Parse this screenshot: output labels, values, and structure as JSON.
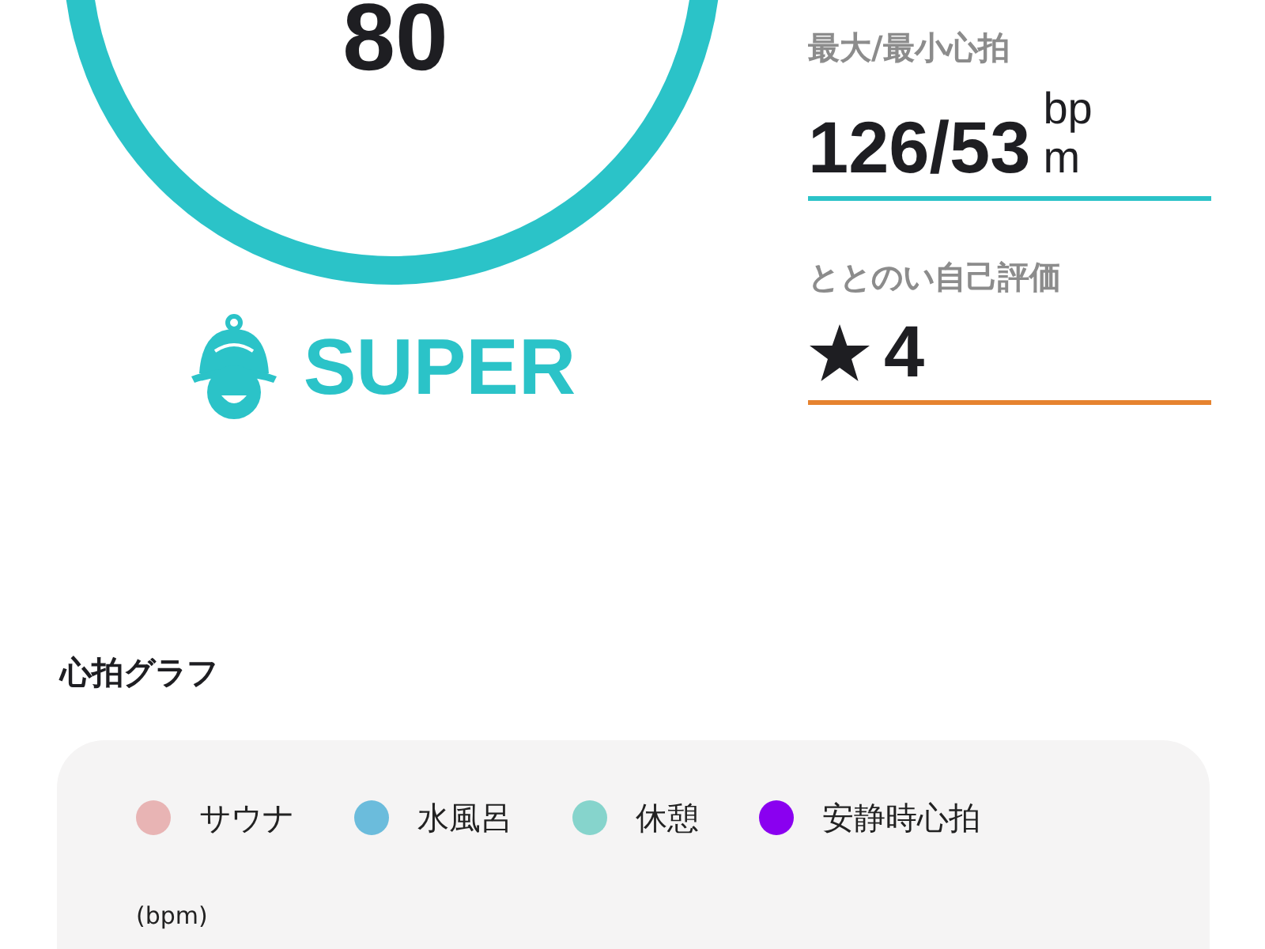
{
  "score": {
    "value": "80",
    "level_label": "SUPER"
  },
  "stats": [
    {
      "label": "最大/最小心拍",
      "value": "126/53",
      "unit": "bpm",
      "color": "#2bc3c8",
      "kind": "number"
    },
    {
      "label": "ととのい自己評価",
      "value": "4",
      "color": "#e6832f",
      "kind": "rating"
    }
  ],
  "graph": {
    "title": "心拍グラフ",
    "legend": [
      {
        "label": "サウナ",
        "color": "#e8b4b4"
      },
      {
        "label": "水風呂",
        "color": "#6bbcdc"
      },
      {
        "label": "休憩",
        "color": "#86d4cc"
      },
      {
        "label": "安静時心拍",
        "color": "#8a00f0"
      }
    ],
    "ylabel": "(bpm)"
  }
}
